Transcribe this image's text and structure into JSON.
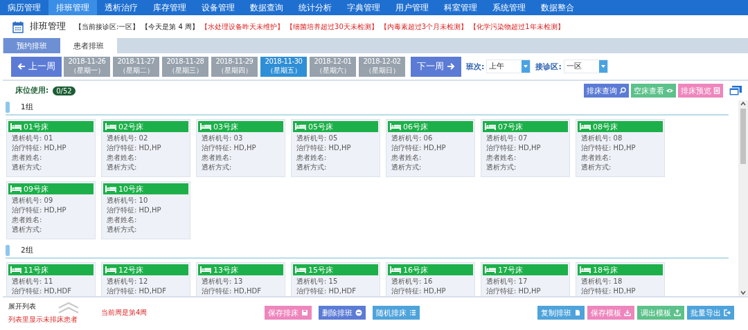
{
  "nav": [
    {
      "label": "病历管理",
      "selected": false
    },
    {
      "label": "排班管理",
      "selected": true
    },
    {
      "label": "透析治疗",
      "selected": false
    },
    {
      "label": "库存管理",
      "selected": false
    },
    {
      "label": "设备管理",
      "selected": false
    },
    {
      "label": "数据查询",
      "selected": false
    },
    {
      "label": "统计分析",
      "selected": false
    },
    {
      "label": "字典管理",
      "selected": false
    },
    {
      "label": "用户管理",
      "selected": false
    },
    {
      "label": "科室管理",
      "selected": false
    },
    {
      "label": "系统管理",
      "selected": false
    },
    {
      "label": "数据整合",
      "selected": false
    }
  ],
  "header": {
    "title": "排班管理",
    "notices": [
      {
        "text": "【当前接诊区:一区】",
        "alert": false
      },
      {
        "text": "【今天是第 4 周】",
        "alert": false
      },
      {
        "text": "【水处理设备昨天未维护】",
        "alert": true
      },
      {
        "text": "【细菌培养超过30天未检测】",
        "alert": true
      },
      {
        "text": "【内毒素超过3个月未检测】",
        "alert": true
      },
      {
        "text": "【化学污染物超过1年未检测】",
        "alert": true
      }
    ]
  },
  "tabs": [
    {
      "label": "预约排班",
      "selected": false
    },
    {
      "label": "患者排班",
      "selected": true
    }
  ],
  "week": {
    "prev": "上一周",
    "next": "下一周",
    "days": [
      {
        "date": "2018-11-26",
        "weekday": "（星期一）",
        "selected": false
      },
      {
        "date": "2018-11-27",
        "weekday": "（星期二）",
        "selected": false
      },
      {
        "date": "2018-11-28",
        "weekday": "（星期三）",
        "selected": false
      },
      {
        "date": "2018-11-29",
        "weekday": "（星期四）",
        "selected": false
      },
      {
        "date": "2018-11-30",
        "weekday": "（星期五）",
        "selected": true
      },
      {
        "date": "2018-12-01",
        "weekday": "（星期六）",
        "selected": false
      },
      {
        "date": "2018-12-02",
        "weekday": "（星期日）",
        "selected": false
      }
    ],
    "filters": [
      {
        "label": "班次:",
        "value": "上午"
      },
      {
        "label": "接诊区:",
        "value": "一区"
      }
    ]
  },
  "bed_usage": {
    "label": "床位使用:",
    "count": "0/52"
  },
  "tools": [
    {
      "label": "排床查询",
      "kind": "search",
      "color": "#5b7bd5"
    },
    {
      "label": "空床查看",
      "kind": "eye",
      "color": "#5cc18a"
    },
    {
      "label": "排床预览",
      "kind": "preview",
      "color": "#ee86bd"
    }
  ],
  "groups": [
    {
      "name": "1组",
      "beds": [
        {
          "title": "01号床",
          "fields": [
            "透析机号: 01",
            "治疗特征: HD,HP",
            "患者姓名:",
            "透析方式:"
          ]
        },
        {
          "title": "02号床",
          "fields": [
            "透析机号: 02",
            "治疗特征: HD,HP",
            "患者姓名:",
            "透析方式:"
          ]
        },
        {
          "title": "03号床",
          "fields": [
            "透析机号: 03",
            "治疗特征: HD,HP",
            "患者姓名:",
            "透析方式:"
          ]
        },
        {
          "title": "05号床",
          "fields": [
            "透析机号: 05",
            "治疗特征: HD,HP",
            "患者姓名:",
            "透析方式:"
          ]
        },
        {
          "title": "06号床",
          "fields": [
            "透析机号: 06",
            "治疗特征: HD,HP",
            "患者姓名:",
            "透析方式:"
          ]
        },
        {
          "title": "07号床",
          "fields": [
            "透析机号: 07",
            "治疗特征: HD,HP",
            "患者姓名:",
            "透析方式:"
          ]
        },
        {
          "title": "08号床",
          "fields": [
            "透析机号: 08",
            "治疗特征: HD,HP",
            "患者姓名:",
            "透析方式:"
          ]
        },
        {
          "title": "09号床",
          "fields": [
            "透析机号: 09",
            "治疗特征: HD,HP",
            "患者姓名:",
            "透析方式:"
          ]
        },
        {
          "title": "10号床",
          "fields": [
            "透析机号: 10",
            "治疗特征: HD,HP",
            "患者姓名:",
            "透析方式:"
          ]
        }
      ]
    },
    {
      "name": "2组",
      "beds": [
        {
          "title": "11号床",
          "fields": [
            "透析机号: 11",
            "治疗特征: HD,HDF"
          ]
        },
        {
          "title": "12号床",
          "fields": [
            "透析机号: 12",
            "治疗特征: HD,HDF"
          ]
        },
        {
          "title": "13号床",
          "fields": [
            "透析机号: 13",
            "治疗特征: HD,HDF"
          ]
        },
        {
          "title": "15号床",
          "fields": [
            "透析机号: 15",
            "治疗特征: HD,HDF"
          ]
        },
        {
          "title": "16号床",
          "fields": [
            "透析机号: 16",
            "治疗特征: HD,HP"
          ]
        },
        {
          "title": "17号床",
          "fields": [
            "透析机号: 17",
            "治疗特征: HD,HP"
          ]
        },
        {
          "title": "18号床",
          "fields": [
            "透析机号: 18",
            "治疗特征: HD,HP"
          ]
        }
      ]
    }
  ],
  "footer": {
    "expand": "展开列表",
    "hint": "列表里显示未排床患者",
    "week_note": "当前周是第4周",
    "left_buttons": [
      {
        "label": "保存排床",
        "kind": "save",
        "color": "#ee86bd"
      },
      {
        "label": "删除排班",
        "kind": "minus",
        "color": "#5b7bd5"
      },
      {
        "label": "随机排床",
        "kind": "list",
        "color": "#4ea3db"
      }
    ],
    "right_buttons": [
      {
        "label": "复制排班",
        "kind": "copy",
        "color": "#4ea3db"
      },
      {
        "label": "保存模板",
        "kind": "download",
        "color": "#ee86bd"
      },
      {
        "label": "调出模板",
        "kind": "upload",
        "color": "#5cc18a"
      },
      {
        "label": "批量导出",
        "kind": "export",
        "color": "#4ea3db"
      }
    ]
  }
}
